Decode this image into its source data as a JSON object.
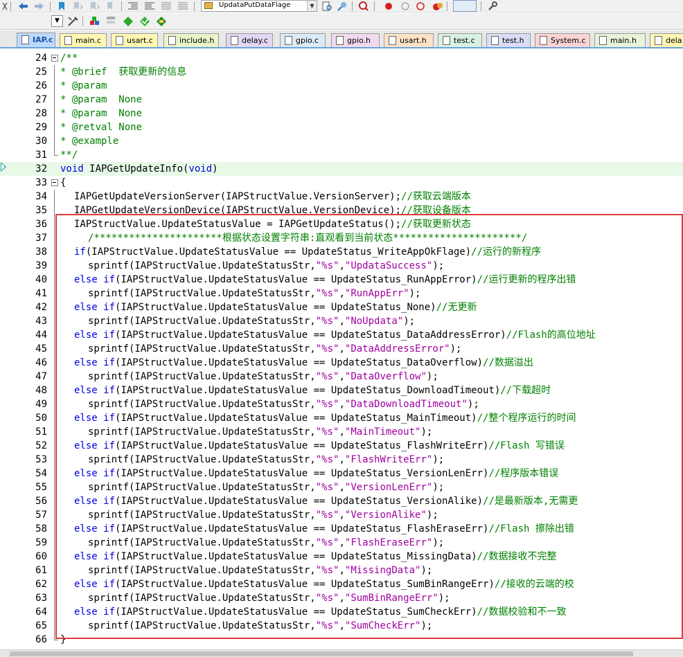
{
  "toolbar": {
    "target_combo": "UpdataPutDataFlage"
  },
  "tabs": [
    {
      "label": "IAP.c",
      "color": "#bcd9ff"
    },
    {
      "label": "main.c",
      "color": "#fff7b3"
    },
    {
      "label": "usart.c",
      "color": "#fff7b3"
    },
    {
      "label": "include.h",
      "color": "#e9f5c9"
    },
    {
      "label": "delay.c",
      "color": "#e2d6f3"
    },
    {
      "label": "gpio.c",
      "color": "#dbeaf5"
    },
    {
      "label": "gpio.h",
      "color": "#f1d9ee"
    },
    {
      "label": "usart.h",
      "color": "#fde2c8"
    },
    {
      "label": "test.c",
      "color": "#d8f1e4"
    },
    {
      "label": "test.h",
      "color": "#dcdcf6"
    },
    {
      "label": "System.c",
      "color": "#fbd3d3"
    },
    {
      "label": "main.h",
      "color": "#e6f3d8"
    },
    {
      "label": "dela",
      "color": "#fff7b3"
    }
  ],
  "editor": {
    "lines": [
      {
        "n": "24",
        "tokens": [
          {
            "t": "/**",
            "c": "c"
          }
        ]
      },
      {
        "n": "25",
        "tokens": [
          {
            "t": "* @brief  获取更新的信息",
            "c": "c"
          }
        ]
      },
      {
        "n": "26",
        "tokens": [
          {
            "t": "* @param",
            "c": "c"
          }
        ]
      },
      {
        "n": "27",
        "tokens": [
          {
            "t": "* @param  None",
            "c": "c"
          }
        ]
      },
      {
        "n": "28",
        "tokens": [
          {
            "t": "* @param  None",
            "c": "c"
          }
        ]
      },
      {
        "n": "29",
        "tokens": [
          {
            "t": "* @retval None",
            "c": "c"
          }
        ]
      },
      {
        "n": "30",
        "tokens": [
          {
            "t": "* @example",
            "c": "c"
          }
        ]
      },
      {
        "n": "31",
        "tokens": [
          {
            "t": "**/",
            "c": "c"
          }
        ]
      },
      {
        "n": "32",
        "tokens": [
          {
            "t": "void",
            "c": "k"
          },
          {
            "t": " IAPGetUpdateInfo(",
            "c": ""
          },
          {
            "t": "void",
            "c": "k"
          },
          {
            "t": ")",
            "c": ""
          }
        ]
      },
      {
        "n": "33",
        "tokens": [
          {
            "t": "{",
            "c": ""
          }
        ]
      },
      {
        "n": "34",
        "tokens": [
          {
            "t": "IAPGetUpdateVersionServer(IAPStructValue.VersionServer);",
            "c": ""
          },
          {
            "t": "//获取云端版本",
            "c": "c"
          }
        ]
      },
      {
        "n": "35",
        "tokens": [
          {
            "t": "IAPGetUpdateVersionDevice(IAPStructValue.VersionDevice);",
            "c": ""
          },
          {
            "t": "//获取设备版本",
            "c": "c"
          }
        ]
      },
      {
        "n": "36",
        "tokens": [
          {
            "t": "IAPStructValue.UpdateStatusValue = IAPGetUpdateStatus();",
            "c": ""
          },
          {
            "t": "//获取更新状态",
            "c": "c"
          }
        ]
      },
      {
        "n": "37",
        "tokens": [
          {
            "t": "/**********************根据状态设置字符串:直观看到当前状态**********************/",
            "c": "c"
          }
        ]
      },
      {
        "n": "38",
        "tokens": [
          {
            "t": "if",
            "c": "k"
          },
          {
            "t": "(IAPStructValue.UpdateStatusValue == UpdateStatus_WriteAppOkFlage)",
            "c": ""
          },
          {
            "t": "//运行的新程序",
            "c": "c"
          }
        ]
      },
      {
        "n": "39",
        "tokens": [
          {
            "t": "sprintf(IAPStructValue.UpdateStatusStr,",
            "c": ""
          },
          {
            "t": "\"%s\"",
            "c": "s"
          },
          {
            "t": ",",
            "c": ""
          },
          {
            "t": "\"UpdataSuccess\"",
            "c": "s"
          },
          {
            "t": ");",
            "c": ""
          }
        ]
      },
      {
        "n": "40",
        "tokens": [
          {
            "t": "else if",
            "c": "k"
          },
          {
            "t": "(IAPStructValue.UpdateStatusValue == UpdateStatus_RunAppError)",
            "c": ""
          },
          {
            "t": "//运行更新的程序出错",
            "c": "c"
          }
        ]
      },
      {
        "n": "41",
        "tokens": [
          {
            "t": "sprintf(IAPStructValue.UpdateStatusStr,",
            "c": ""
          },
          {
            "t": "\"%s\"",
            "c": "s"
          },
          {
            "t": ",",
            "c": ""
          },
          {
            "t": "\"RunAppErr\"",
            "c": "s"
          },
          {
            "t": ");",
            "c": ""
          }
        ]
      },
      {
        "n": "42",
        "tokens": [
          {
            "t": "else if",
            "c": "k"
          },
          {
            "t": "(IAPStructValue.UpdateStatusValue == UpdateStatus_None)",
            "c": ""
          },
          {
            "t": "//无更新",
            "c": "c"
          }
        ]
      },
      {
        "n": "43",
        "tokens": [
          {
            "t": "sprintf(IAPStructValue.UpdateStatusStr,",
            "c": ""
          },
          {
            "t": "\"%s\"",
            "c": "s"
          },
          {
            "t": ",",
            "c": ""
          },
          {
            "t": "\"NoUpdata\"",
            "c": "s"
          },
          {
            "t": ");",
            "c": ""
          }
        ]
      },
      {
        "n": "44",
        "tokens": [
          {
            "t": "else if",
            "c": "k"
          },
          {
            "t": "(IAPStructValue.UpdateStatusValue == UpdateStatus_DataAddressError)",
            "c": ""
          },
          {
            "t": "//Flash的高位地址",
            "c": "c"
          }
        ]
      },
      {
        "n": "45",
        "tokens": [
          {
            "t": "sprintf(IAPStructValue.UpdateStatusStr,",
            "c": ""
          },
          {
            "t": "\"%s\"",
            "c": "s"
          },
          {
            "t": ",",
            "c": ""
          },
          {
            "t": "\"DataAddressError\"",
            "c": "s"
          },
          {
            "t": ");",
            "c": ""
          }
        ]
      },
      {
        "n": "46",
        "tokens": [
          {
            "t": "else if",
            "c": "k"
          },
          {
            "t": "(IAPStructValue.UpdateStatusValue == UpdateStatus_DataOverflow)",
            "c": ""
          },
          {
            "t": "//数据溢出",
            "c": "c"
          }
        ]
      },
      {
        "n": "47",
        "tokens": [
          {
            "t": "sprintf(IAPStructValue.UpdateStatusStr,",
            "c": ""
          },
          {
            "t": "\"%s\"",
            "c": "s"
          },
          {
            "t": ",",
            "c": ""
          },
          {
            "t": "\"DataOverflow\"",
            "c": "s"
          },
          {
            "t": ");",
            "c": ""
          }
        ]
      },
      {
        "n": "48",
        "tokens": [
          {
            "t": "else if",
            "c": "k"
          },
          {
            "t": "(IAPStructValue.UpdateStatusValue == UpdateStatus_DownloadTimeout)",
            "c": ""
          },
          {
            "t": "//下载超时",
            "c": "c"
          }
        ]
      },
      {
        "n": "49",
        "tokens": [
          {
            "t": "sprintf(IAPStructValue.UpdateStatusStr,",
            "c": ""
          },
          {
            "t": "\"%s\"",
            "c": "s"
          },
          {
            "t": ",",
            "c": ""
          },
          {
            "t": "\"DataDownloadTimeout\"",
            "c": "s"
          },
          {
            "t": ");",
            "c": ""
          }
        ]
      },
      {
        "n": "50",
        "tokens": [
          {
            "t": "else if",
            "c": "k"
          },
          {
            "t": "(IAPStructValue.UpdateStatusValue == UpdateStatus_MainTimeout)",
            "c": ""
          },
          {
            "t": "//整个程序运行的时间",
            "c": "c"
          }
        ]
      },
      {
        "n": "51",
        "tokens": [
          {
            "t": "sprintf(IAPStructValue.UpdateStatusStr,",
            "c": ""
          },
          {
            "t": "\"%s\"",
            "c": "s"
          },
          {
            "t": ",",
            "c": ""
          },
          {
            "t": "\"MainTimeout\"",
            "c": "s"
          },
          {
            "t": ");",
            "c": ""
          }
        ]
      },
      {
        "n": "52",
        "tokens": [
          {
            "t": "else if",
            "c": "k"
          },
          {
            "t": "(IAPStructValue.UpdateStatusValue == UpdateStatus_FlashWriteErr)",
            "c": ""
          },
          {
            "t": "//Flash 写错误",
            "c": "c"
          }
        ]
      },
      {
        "n": "53",
        "tokens": [
          {
            "t": "sprintf(IAPStructValue.UpdateStatusStr,",
            "c": ""
          },
          {
            "t": "\"%s\"",
            "c": "s"
          },
          {
            "t": ",",
            "c": ""
          },
          {
            "t": "\"FlashWriteErr\"",
            "c": "s"
          },
          {
            "t": ");",
            "c": ""
          }
        ]
      },
      {
        "n": "54",
        "tokens": [
          {
            "t": "else if",
            "c": "k"
          },
          {
            "t": "(IAPStructValue.UpdateStatusValue == UpdateStatus_VersionLenErr)",
            "c": ""
          },
          {
            "t": "//程序版本错误",
            "c": "c"
          }
        ]
      },
      {
        "n": "55",
        "tokens": [
          {
            "t": "sprintf(IAPStructValue.UpdateStatusStr,",
            "c": ""
          },
          {
            "t": "\"%s\"",
            "c": "s"
          },
          {
            "t": ",",
            "c": ""
          },
          {
            "t": "\"VersionLenErr\"",
            "c": "s"
          },
          {
            "t": ");",
            "c": ""
          }
        ]
      },
      {
        "n": "56",
        "tokens": [
          {
            "t": "else if",
            "c": "k"
          },
          {
            "t": "(IAPStructValue.UpdateStatusValue == UpdateStatus_VersionAlike)",
            "c": ""
          },
          {
            "t": "//是最新版本,无需更",
            "c": "c"
          }
        ]
      },
      {
        "n": "57",
        "tokens": [
          {
            "t": "sprintf(IAPStructValue.UpdateStatusStr,",
            "c": ""
          },
          {
            "t": "\"%s\"",
            "c": "s"
          },
          {
            "t": ",",
            "c": ""
          },
          {
            "t": "\"VersionAlike\"",
            "c": "s"
          },
          {
            "t": ");",
            "c": ""
          }
        ]
      },
      {
        "n": "58",
        "tokens": [
          {
            "t": "else if",
            "c": "k"
          },
          {
            "t": "(IAPStructValue.UpdateStatusValue == UpdateStatus_FlashEraseErr)",
            "c": ""
          },
          {
            "t": "//Flash 擦除出错",
            "c": "c"
          }
        ]
      },
      {
        "n": "59",
        "tokens": [
          {
            "t": "sprintf(IAPStructValue.UpdateStatusStr,",
            "c": ""
          },
          {
            "t": "\"%s\"",
            "c": "s"
          },
          {
            "t": ",",
            "c": ""
          },
          {
            "t": "\"FlashEraseErr\"",
            "c": "s"
          },
          {
            "t": ");",
            "c": ""
          }
        ]
      },
      {
        "n": "60",
        "tokens": [
          {
            "t": "else if",
            "c": "k"
          },
          {
            "t": "(IAPStructValue.UpdateStatusValue == UpdateStatus_MissingData)",
            "c": ""
          },
          {
            "t": "//数据接收不完整",
            "c": "c"
          }
        ]
      },
      {
        "n": "61",
        "tokens": [
          {
            "t": "sprintf(IAPStructValue.UpdateStatusStr,",
            "c": ""
          },
          {
            "t": "\"%s\"",
            "c": "s"
          },
          {
            "t": ",",
            "c": ""
          },
          {
            "t": "\"MissingData\"",
            "c": "s"
          },
          {
            "t": ");",
            "c": ""
          }
        ]
      },
      {
        "n": "62",
        "tokens": [
          {
            "t": "else if",
            "c": "k"
          },
          {
            "t": "(IAPStructValue.UpdateStatusValue == UpdateStatus_SumBinRangeErr)",
            "c": ""
          },
          {
            "t": "//接收的云端的校",
            "c": "c"
          }
        ]
      },
      {
        "n": "63",
        "tokens": [
          {
            "t": "sprintf(IAPStructValue.UpdateStatusStr,",
            "c": ""
          },
          {
            "t": "\"%s\"",
            "c": "s"
          },
          {
            "t": ",",
            "c": ""
          },
          {
            "t": "\"SumBinRangeErr\"",
            "c": "s"
          },
          {
            "t": ");",
            "c": ""
          }
        ]
      },
      {
        "n": "64",
        "tokens": [
          {
            "t": "else if",
            "c": "k"
          },
          {
            "t": "(IAPStructValue.UpdateStatusValue == UpdateStatus_SumCheckErr)",
            "c": ""
          },
          {
            "t": "//数据校验和不一致",
            "c": "c"
          }
        ]
      },
      {
        "n": "65",
        "tokens": [
          {
            "t": "sprintf(IAPStructValue.UpdateStatusStr,",
            "c": ""
          },
          {
            "t": "\"%s\"",
            "c": "s"
          },
          {
            "t": ",",
            "c": ""
          },
          {
            "t": "\"SumCheckErr\"",
            "c": "s"
          },
          {
            "t": ");",
            "c": ""
          }
        ]
      },
      {
        "n": "66",
        "tokens": [
          {
            "t": "}",
            "c": ""
          }
        ]
      }
    ]
  },
  "colors": {
    "comment": "#008000",
    "keyword": "#0000e0",
    "string": "#a000a0",
    "current_line": "#e8f9e8",
    "highlight_box": "#e03a3a"
  }
}
